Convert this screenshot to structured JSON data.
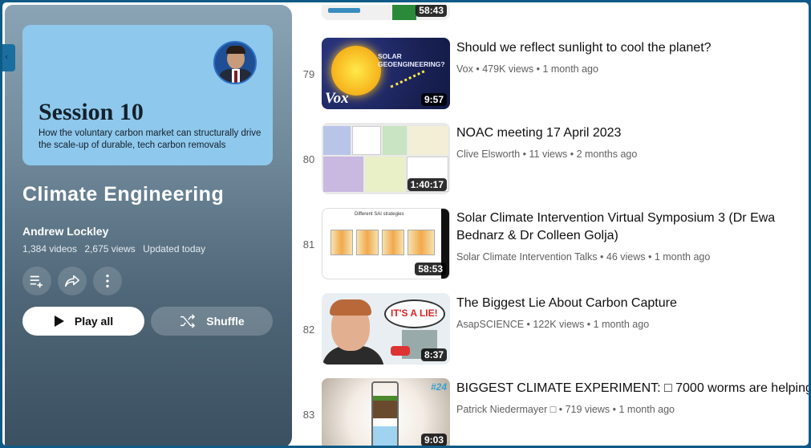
{
  "playlist": {
    "thumbnail": {
      "heading": "Session 10",
      "subtitle": "How the voluntary carbon market can structurally drive the scale-up of durable, tech carbon removals"
    },
    "title": "Climate Engineering",
    "owner": "Andrew Lockley",
    "video_count": "1,384 videos",
    "views": "2,675 views",
    "updated": "Updated today",
    "play_all_label": "Play all",
    "shuffle_label": "Shuffle"
  },
  "videos": [
    {
      "index": "",
      "duration": "58:43",
      "title": "",
      "channel": "",
      "views": "",
      "age": ""
    },
    {
      "index": "79",
      "duration": "9:57",
      "title": "Should we reflect sunlight to cool the planet?",
      "channel": "Vox",
      "views": "479K views",
      "age": "1 month ago",
      "thumb_text": "SOLAR GEOENGINEERING?",
      "thumb_logo": "Vox"
    },
    {
      "index": "80",
      "duration": "1:40:17",
      "title": "NOAC meeting 17 April 2023",
      "channel": "Clive Elsworth",
      "views": "11 views",
      "age": "2 months ago"
    },
    {
      "index": "81",
      "duration": "58:53",
      "title": "Solar Climate Intervention Virtual Symposium 3 (Dr Ewa Bednarz & Dr Colleen Golja)",
      "channel": "Solar Climate Intervention Talks",
      "views": "46 views",
      "age": "1 month ago",
      "thumb_text": "Different SAI strategies"
    },
    {
      "index": "82",
      "duration": "8:37",
      "title": "The Biggest Lie About Carbon Capture",
      "channel": "AsapSCIENCE",
      "views": "122K views",
      "age": "1 month ago",
      "thumb_text": "IT'S A LIE!"
    },
    {
      "index": "83",
      "duration": "9:03",
      "title": "BIGGEST CLIMATE EXPERIMENT: □ 7000 worms are helping",
      "channel": "Patrick Niedermayer □",
      "views": "719 views",
      "age": "1 month ago",
      "thumb_text": "#24"
    }
  ],
  "colors": {
    "frame": "#0f5a86",
    "panel_top": "#8aa4b6",
    "panel_bottom": "#3b5061",
    "thumb_bg": "#8ec8ec"
  },
  "icons": [
    "add-to-queue-icon",
    "share-icon",
    "more-vert-icon",
    "play-icon",
    "shuffle-icon"
  ]
}
